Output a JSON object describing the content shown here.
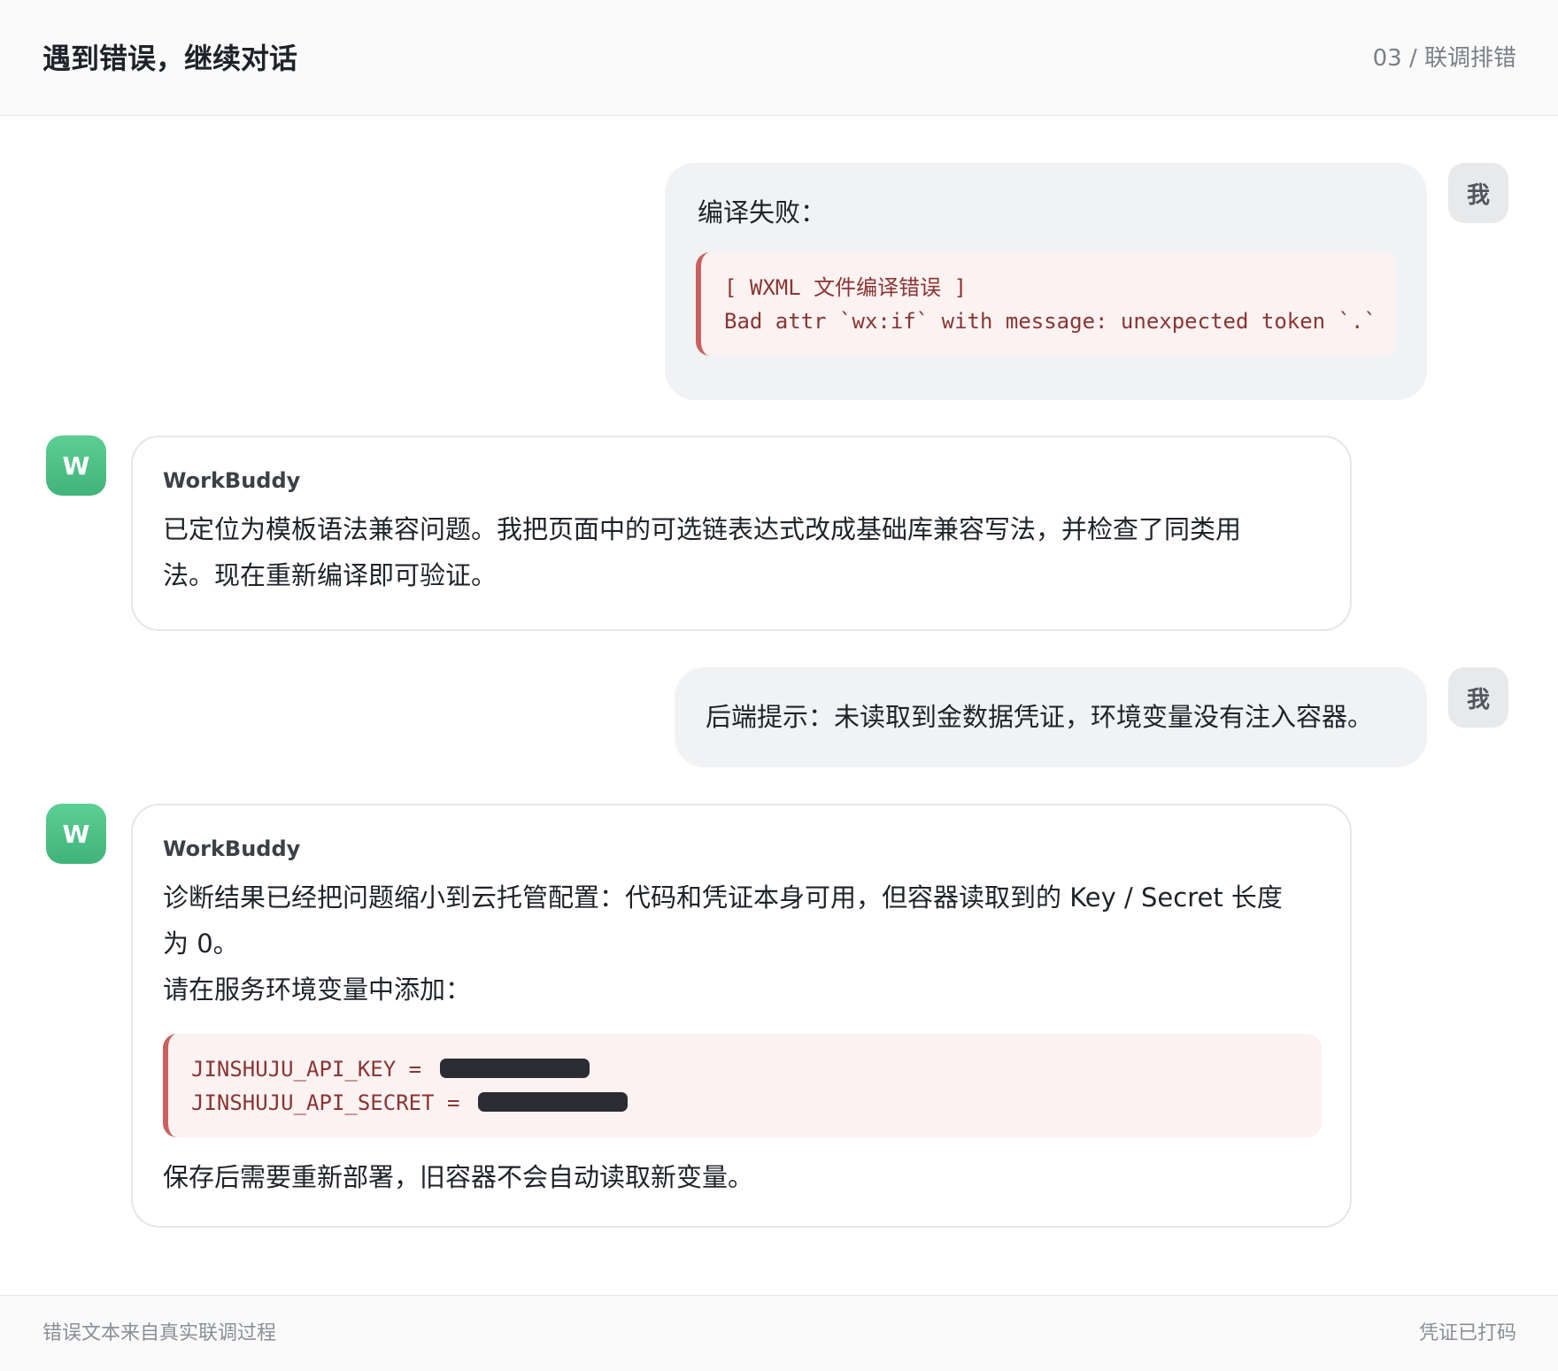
{
  "header": {
    "title": "遇到错误，继续对话",
    "step": "03 / 联调排错"
  },
  "footer": {
    "left": "错误文本来自真实联调过程",
    "right": "凭证已打码"
  },
  "messages": [
    {
      "role": "me",
      "avatar": "我",
      "intro": "编译失败：",
      "code": [
        "[ WXML 文件编译错误 ]",
        "Bad attr `wx:if` with message: unexpected token `.`"
      ]
    },
    {
      "role": "bot",
      "avatar": "W",
      "sender": "WorkBuddy",
      "lines": [
        "已定位为模板语法兼容问题。我把页面中的可选链表达式改成基础库兼容写法，并检查了同类用",
        "法。现在重新编译即可验证。"
      ]
    },
    {
      "role": "me",
      "avatar": "我",
      "text": "后端提示：未读取到金数据凭证，环境变量没有注入容器。"
    },
    {
      "role": "bot",
      "avatar": "W",
      "sender": "WorkBuddy",
      "lines": [
        "诊断结果已经把问题缩小到云托管配置：代码和凭证本身可用，但容器读取到的 Key / Secret 长度",
        "为 0。",
        "请在服务环境变量中添加："
      ],
      "code": [
        "JINSHUJU_API_KEY =",
        "JINSHUJU_API_SECRET ="
      ],
      "outro": "保存后需要重新部署，旧容器不会自动读取新变量。"
    }
  ]
}
